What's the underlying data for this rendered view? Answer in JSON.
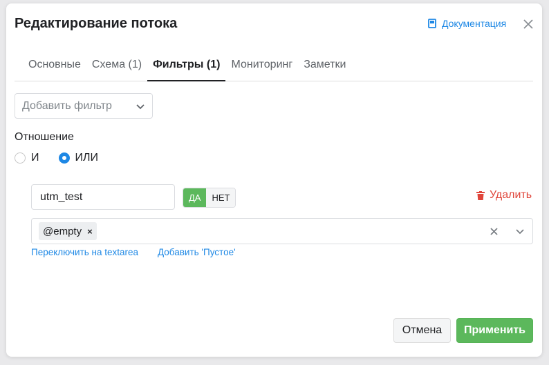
{
  "dialog": {
    "title": "Редактирование потока",
    "doc_link": "Документация"
  },
  "tabs": [
    {
      "label": "Основные",
      "active": false
    },
    {
      "label": "Схема (1)",
      "active": false
    },
    {
      "label": "Фильтры (1)",
      "active": true
    },
    {
      "label": "Мониторинг",
      "active": false
    },
    {
      "label": "Заметки",
      "active": false
    }
  ],
  "add_filter": {
    "placeholder": "Добавить фильтр"
  },
  "relation": {
    "label": "Отношение",
    "options": [
      {
        "label": "И",
        "checked": false
      },
      {
        "label": "ИЛИ",
        "checked": true
      }
    ]
  },
  "filter": {
    "name_value": "utm_test",
    "toggle_yes": "ДА",
    "toggle_no": "НЕТ",
    "toggle_selected": "ДА",
    "delete_label": "Удалить",
    "tags": [
      "@empty"
    ],
    "switch_textarea_link": "Переключить на textarea",
    "add_empty_link": "Добавить 'Пустое'"
  },
  "footer": {
    "cancel_label": "Отмена",
    "apply_label": "Применить"
  },
  "colors": {
    "accent": "#1e88e5",
    "success": "#5cb85c",
    "danger": "#e0463b"
  }
}
